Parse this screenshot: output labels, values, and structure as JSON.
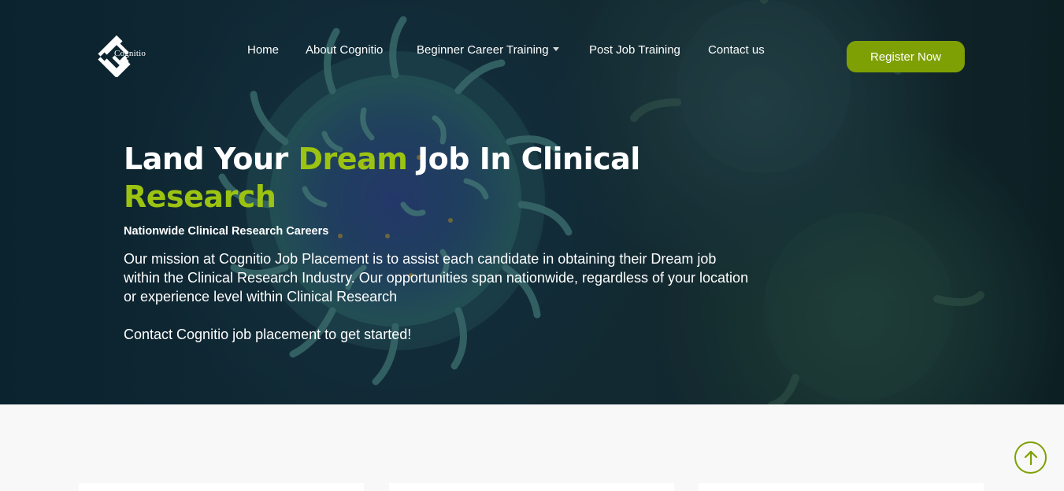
{
  "brand": {
    "name": "Cognitio",
    "logo_icon": "diamond-chain-logo-icon"
  },
  "nav": {
    "items": [
      {
        "label": "Home"
      },
      {
        "label": "About Cognitio"
      },
      {
        "label": "Beginner Career Training",
        "has_dropdown": true
      },
      {
        "label": "Post Job Training"
      },
      {
        "label": "Contact us"
      }
    ]
  },
  "header": {
    "register_label": "Register Now"
  },
  "hero": {
    "headline_part1": "Land Your ",
    "headline_accent1": "Dream",
    "headline_part2": " Job In Clinical ",
    "headline_accent2": "Research",
    "subheading": "Nationwide Clinical Research Careers",
    "description": "Our mission at Cognitio Job Placement is to assist each candidate in obtaining their Dream job within the Clinical Research Industry. Our opportunities span nationwide, regardless of your location or experience level within Clinical Research",
    "cta_text": "Contact Cognitio job placement to get started!"
  },
  "scroll_top": {
    "icon": "arrow-up-icon"
  },
  "colors": {
    "accent": "#9cc311",
    "button": "#7fa004",
    "hero_bg": "#132f3c",
    "page_bg": "#f8f8f8"
  }
}
